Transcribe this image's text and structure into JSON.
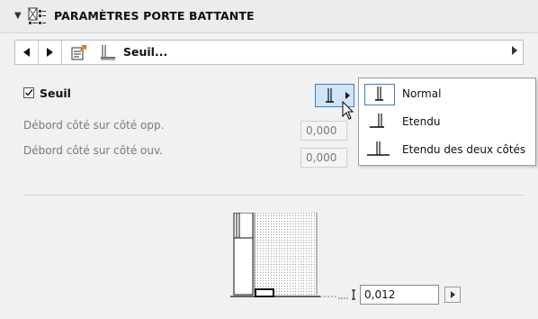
{
  "panel": {
    "title": "PARAMÈTRES PORTE BATTANTE",
    "collapse_icon": "triangle-down-icon",
    "title_icon": "door-settings-icon"
  },
  "nav": {
    "prev_icon": "triangle-left-icon",
    "next_icon": "triangle-right-icon",
    "doc_icon": "document-arrow-icon",
    "section_icon": "threshold-icon",
    "label": "Seuil...",
    "more_icon": "triangle-right-icon"
  },
  "seuil": {
    "checkbox_label": "Seuil",
    "checked": true
  },
  "fields": {
    "opp_label": "Débord côté sur côté opp.",
    "opp_value": "0,000",
    "ouv_label": "Débord côté sur côté ouv.",
    "ouv_value": "0,000"
  },
  "dropdown": {
    "options": [
      {
        "label": "Normal",
        "selected": true,
        "icon": "threshold-normal-icon"
      },
      {
        "label": "Etendu",
        "selected": false,
        "icon": "threshold-extended-icon"
      },
      {
        "label": "Etendu des deux côtés",
        "selected": false,
        "icon": "threshold-both-sides-icon"
      }
    ]
  },
  "preview": {
    "value": "0,012",
    "value_icon": "height-dimension-icon",
    "arrow_icon": "triangle-right-icon"
  },
  "colors": {
    "accent": "#3a7fc6",
    "selected_bg": "#cfe4f6",
    "disabled_text": "#7a7a7a"
  }
}
